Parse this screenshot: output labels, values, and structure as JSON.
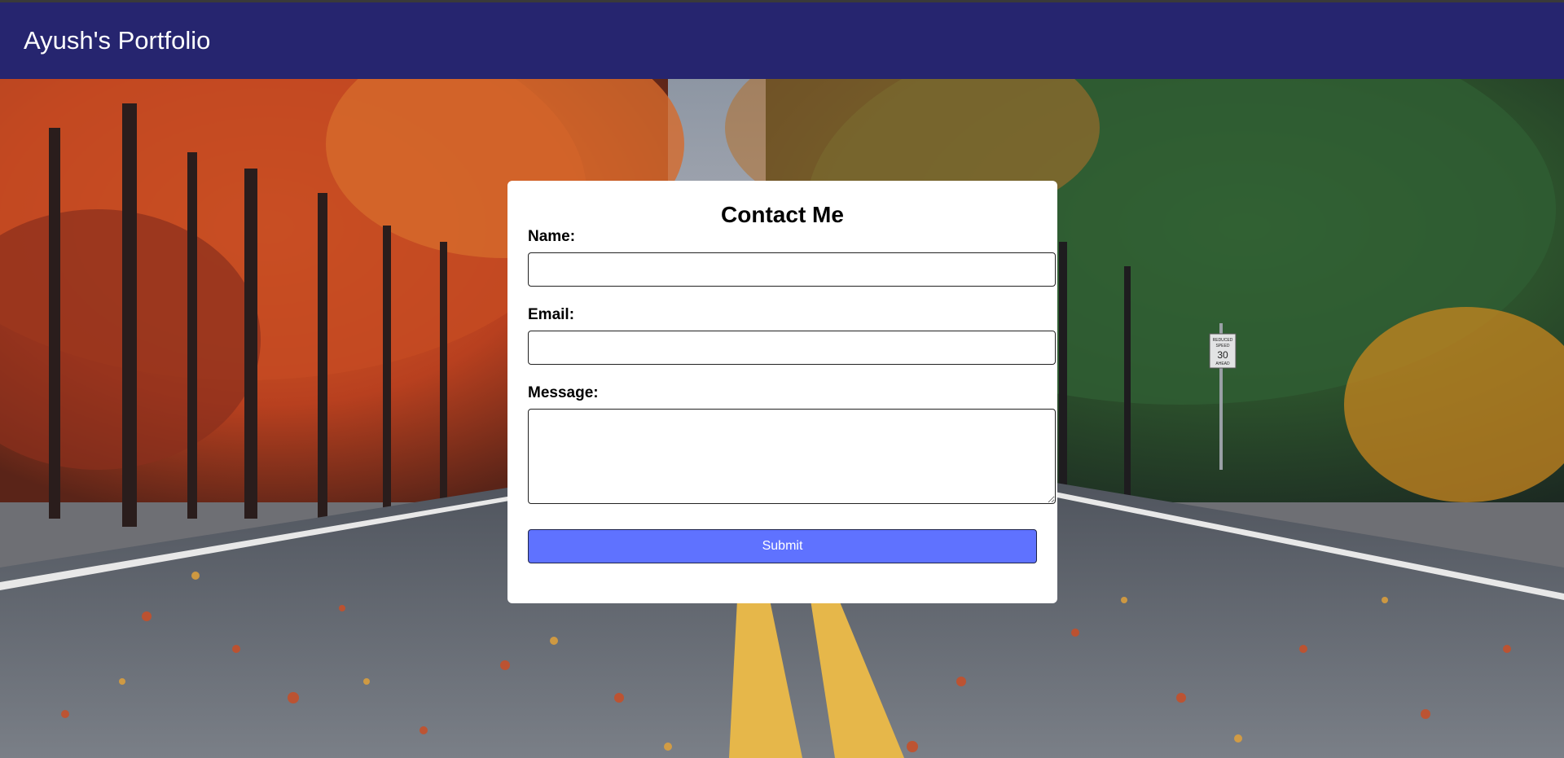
{
  "header": {
    "title": "Ayush's Portfolio"
  },
  "contact": {
    "heading": "Contact Me",
    "name_label": "Name:",
    "name_value": "",
    "email_label": "Email:",
    "email_value": "",
    "message_label": "Message:",
    "message_value": "",
    "submit_label": "Submit"
  },
  "sign": {
    "line1": "REDUCED",
    "line2": "SPEED",
    "line3": "30",
    "line4": "AHEAD"
  },
  "colors": {
    "header_bg": "#26256f",
    "submit_bg": "#5f72ff",
    "card_bg": "#ffffff"
  }
}
